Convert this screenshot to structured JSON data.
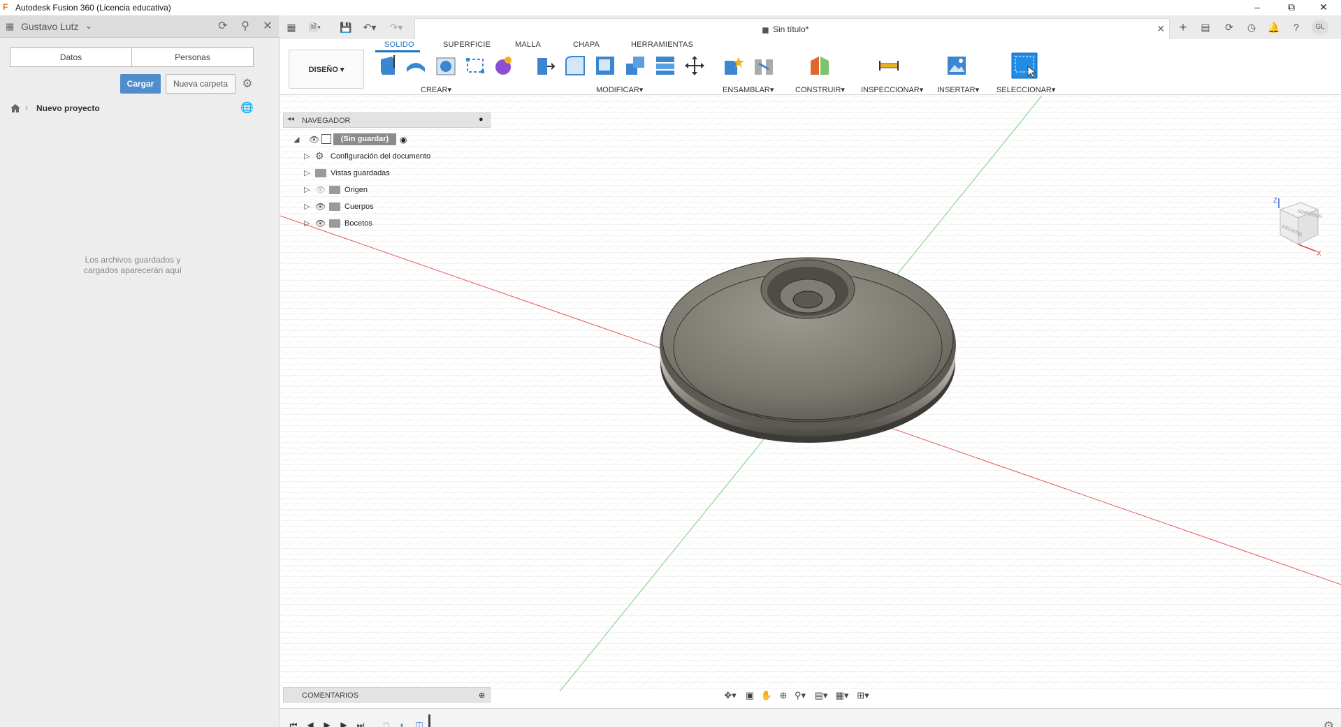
{
  "app": {
    "title": "Autodesk Fusion 360 (Licencia educativa)",
    "window_controls": [
      "minimize",
      "restore",
      "close"
    ]
  },
  "data_panel": {
    "user": "Gustavo Lutz",
    "tabs": [
      "Datos",
      "Personas"
    ],
    "upload_label": "Cargar",
    "new_folder_label": "Nueva carpeta",
    "breadcrumb_project": "Nuevo proyecto",
    "empty_message_line1": "Los archivos guardados y",
    "empty_message_line2": "cargados aparecerán aquí",
    "header_icons": [
      "refresh-icon",
      "search-icon",
      "close-icon"
    ]
  },
  "document": {
    "title": "Sin título*"
  },
  "ribbon": {
    "tabs": [
      "SOLIDO",
      "SUPERFICIE",
      "MALLA",
      "CHAPA",
      "HERRAMIENTAS"
    ],
    "active_tab": "SOLIDO",
    "workspace": "DISEÑO",
    "groups": [
      "CREAR",
      "MODIFICAR",
      "ENSAMBLAR",
      "CONSTRUIR",
      "INSPECCIONAR",
      "INSERTAR",
      "SELECCIONAR"
    ]
  },
  "navigator": {
    "title": "NAVEGADOR",
    "root": "(Sin guardar)",
    "items": [
      "Configuración del documento",
      "Vistas guardadas",
      "Origen",
      "Cuerpos",
      "Bocetos"
    ]
  },
  "comments": {
    "title": "COMENTARIOS"
  },
  "viewcube": {
    "top_label": "SUPERIOR",
    "front_label": "FRONTAL",
    "axis_z": "Z",
    "axis_x": "X"
  },
  "colors": {
    "accent": "#1a73c8",
    "upload_button": "#4f8dcc",
    "axis_red": "#e25a5a",
    "axis_green": "#7ccf7c",
    "model": "#8a877e"
  }
}
